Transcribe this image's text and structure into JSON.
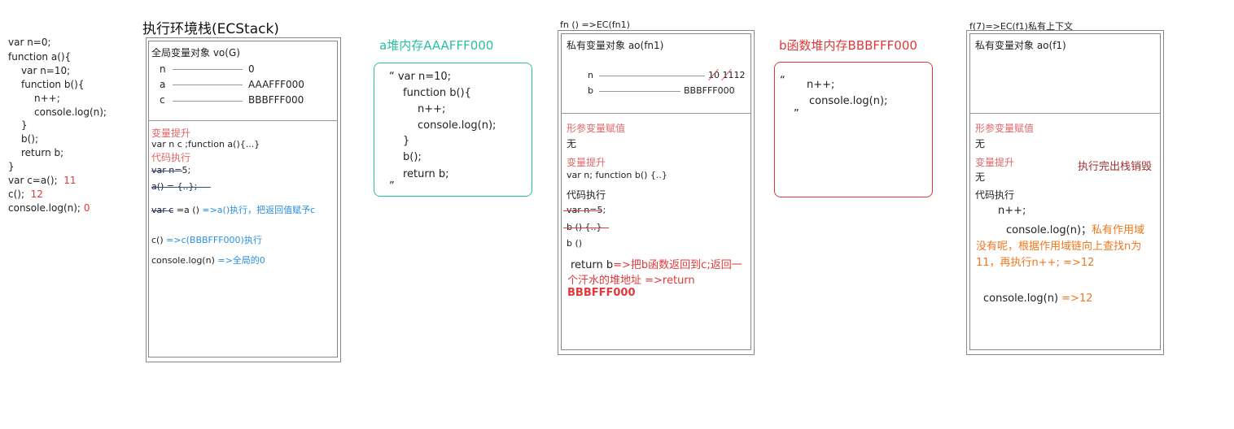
{
  "left_code": {
    "lines": [
      "var n=0;",
      "function a(){",
      "var n=10;",
      "function b(){",
      "n++;",
      "console.log(n);",
      "}",
      "b();",
      "return b;",
      "}",
      "var c=a();",
      "c();",
      "console.log(n);"
    ],
    "annot_1": "11",
    "annot_2": "12",
    "annot_3": "0"
  },
  "ecstack": {
    "title": "执行环境栈(ECStack)",
    "vo_title": "全局变量对象 vo(G)",
    "vars": [
      {
        "name": "n",
        "value": "0"
      },
      {
        "name": "a",
        "value": "AAAFFF000"
      },
      {
        "name": "c",
        "value": "BBBFFF000"
      }
    ],
    "hoist_label": "变量提升",
    "hoist_code": "var n c ;function a(){...}",
    "exec_label": "代码执行",
    "exec_1": "var n=5;",
    "exec_2": "a() = {..};",
    "exec_3a": "var c",
    "exec_3b": " =a () ",
    "exec_3c": "=>a()执行，把返回值赋予c",
    "exec_4a": "c() ",
    "exec_4b": "=>c(BBBFFF000)执行",
    "exec_5a": "console.log(n) ",
    "exec_5b": "=>全局的0"
  },
  "heap_a": {
    "title": "a堆内存AAAFFF000",
    "lines": [
      "“   var n=10;",
      "function b(){",
      "n++;",
      "console.log(n);",
      "}",
      "b();",
      "return b;",
      "”"
    ]
  },
  "ec_fn1": {
    "caption": "fn  ()  =>EC(fn1)",
    "ao_title": "私有变量对象 ao(fn1)",
    "var_n": "n",
    "val_n": "10  1112",
    "var_b": "b",
    "val_b": "BBBFFF000",
    "param_label": "形参变量赋值",
    "param_val": "无",
    "hoist_label": "变量提升",
    "hoist_code": "var n; function b() {..}",
    "exec_label": "代码执行",
    "exec_1": "var n=5;",
    "exec_2": "b () {..}",
    "exec_3": "b ()",
    "return_a": "return b",
    "return_b": "=>把b函数返回到c;返回一",
    "return_c": "个汗水的堆地址 =>return",
    "return_d": "BBBFFF000"
  },
  "heap_b": {
    "title": "b函数堆内存BBBFFF000",
    "lines": [
      "“",
      "n++;",
      "console.log(n);",
      "”"
    ]
  },
  "ec_f1": {
    "caption": "f(7)=>EC(f1)私有上下文",
    "ao_title": "私有变量对象 ao(f1)",
    "param_label": "形参变量赋值",
    "param_val": "无",
    "hoist_label": "变量提升",
    "hoist_val": "无",
    "destroy_note": "执行完出栈销毁",
    "exec_label": "代码执行",
    "exec_1": "n++;",
    "exec_2a": "console.log(n)；",
    "exec_2b": "私有作用域",
    "exec_2c": "没有呢，根据作用域链向上查找n为",
    "exec_2d": "11，再执行n++; =>12",
    "exec_3a": "console.log(n) ",
    "exec_3b": "=>12"
  },
  "colors": {
    "red": "#e0393a",
    "teal": "#2bbfa4",
    "blue": "#2a8fe0",
    "orange": "#f0781e",
    "pink": "#e06666"
  }
}
